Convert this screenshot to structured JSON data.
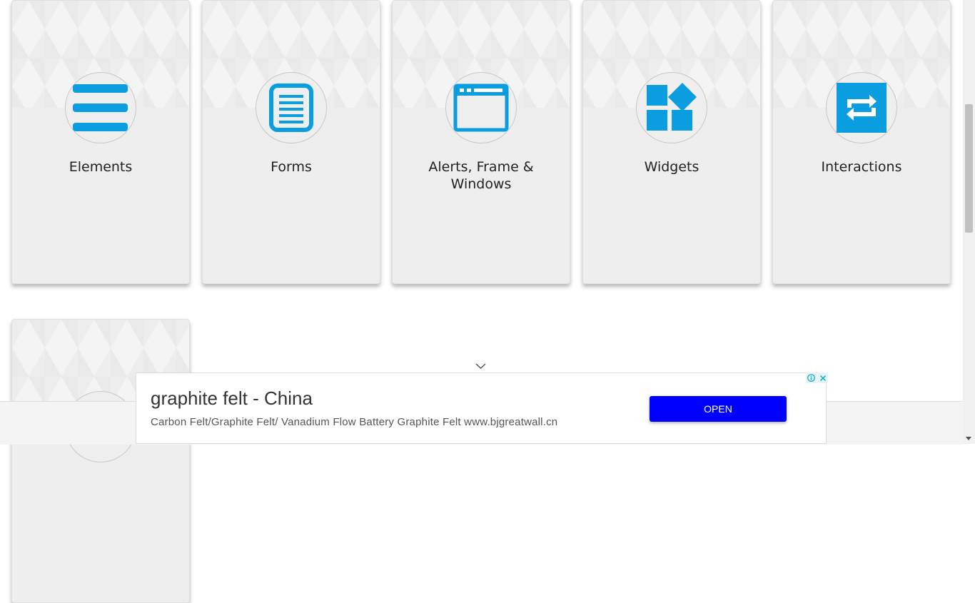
{
  "cards": [
    {
      "label": "Elements",
      "icon": "hamburger-menu-icon"
    },
    {
      "label": "Forms",
      "icon": "document-icon"
    },
    {
      "label": "Alerts, Frame & Windows",
      "icon": "browser-window-icon"
    },
    {
      "label": "Widgets",
      "icon": "widgets-icon"
    },
    {
      "label": "Interactions",
      "icon": "swap-arrows-icon"
    }
  ],
  "partial_card": {
    "icon": "book-icon"
  },
  "ad": {
    "title": "graphite felt - China",
    "description": "Carbon Felt/Graphite Felt/ Vanadium Flow Battery Graphite Felt www.bjgreatwall.cn",
    "button_label": "OPEN",
    "choices_icons": [
      "info-icon",
      "close-icon"
    ]
  },
  "colors": {
    "accent": "#0a9ee0",
    "ad_button": "#0000ff",
    "card_background": "#eeeeee"
  }
}
